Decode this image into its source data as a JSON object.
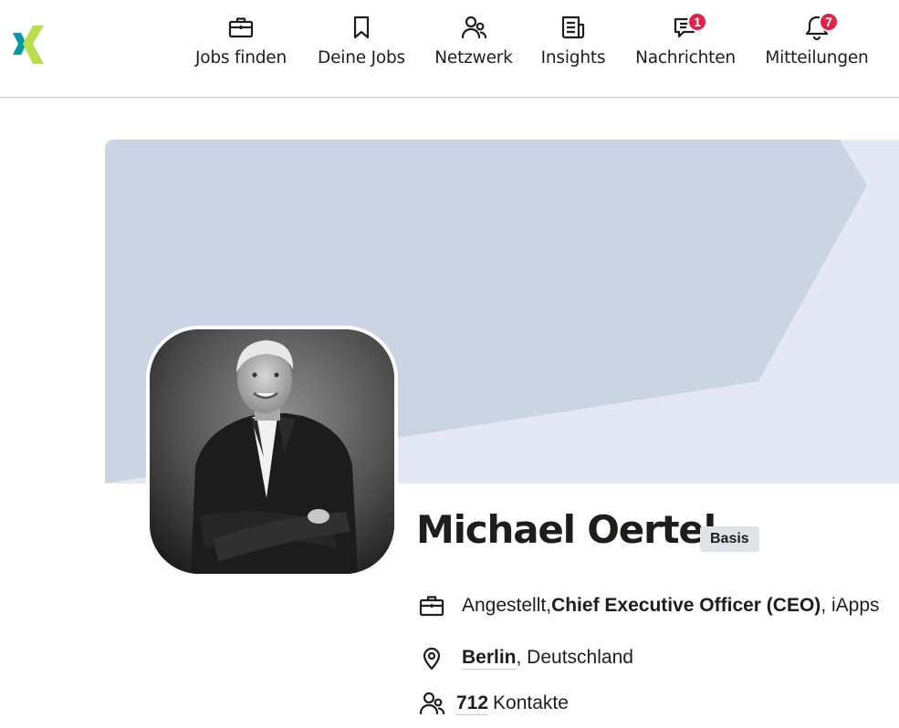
{
  "nav": {
    "items": [
      {
        "label": "Jobs finden",
        "icon": "briefcase-icon"
      },
      {
        "label": "Deine Jobs",
        "icon": "bookmark-icon"
      },
      {
        "label": "Netzwerk",
        "icon": "people-icon"
      },
      {
        "label": "Insights",
        "icon": "newspaper-icon"
      },
      {
        "label": "Nachrichten",
        "icon": "chat-icon",
        "badge": "1"
      },
      {
        "label": "Mitteilungen",
        "icon": "bell-icon",
        "badge": "7"
      }
    ]
  },
  "profile": {
    "name": "Michael Oertel",
    "membership": "Basis",
    "employment": {
      "status": "Angestellt, ",
      "title": "Chief Executive Officer (CEO)",
      "company": ", iApps"
    },
    "location": {
      "city": "Berlin",
      "country": ", Deutschland"
    },
    "contacts": {
      "count": "712",
      "label": "Kontakte"
    }
  },
  "colors": {
    "brand_teal": "#0698a0",
    "brand_lime": "#b7df4b",
    "badge_red": "#e31f4c",
    "cover_dark": "#cbd4e3",
    "cover_light": "#e3e8f4"
  }
}
